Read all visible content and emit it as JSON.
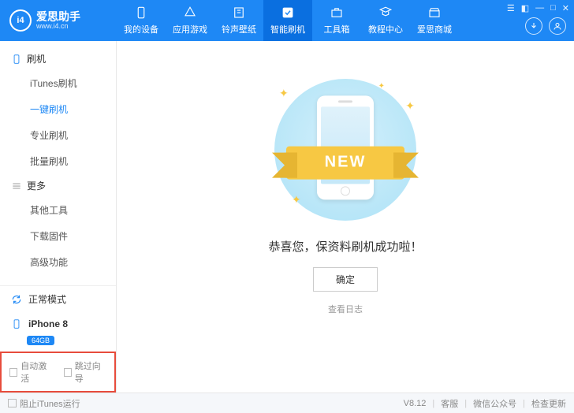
{
  "logo": {
    "badge": "i4",
    "title": "爱思助手",
    "url": "www.i4.cn"
  },
  "nav": [
    {
      "label": "我的设备",
      "icon": "device"
    },
    {
      "label": "应用游戏",
      "icon": "apps"
    },
    {
      "label": "铃声壁纸",
      "icon": "ringtone"
    },
    {
      "label": "智能刷机",
      "icon": "flash",
      "active": true
    },
    {
      "label": "工具箱",
      "icon": "toolbox"
    },
    {
      "label": "教程中心",
      "icon": "tutorial"
    },
    {
      "label": "爱思商城",
      "icon": "store"
    }
  ],
  "sidebar": {
    "group1": {
      "title": "刷机",
      "items": [
        "iTunes刷机",
        "一键刷机",
        "专业刷机",
        "批量刷机"
      ],
      "activeIndex": 1
    },
    "group2": {
      "title": "更多",
      "items": [
        "其他工具",
        "下载固件",
        "高级功能"
      ]
    },
    "mode": "正常模式",
    "device": {
      "name": "iPhone 8",
      "storage": "64GB"
    },
    "checks": {
      "autoActivate": "自动激活",
      "skipGuide": "跳过向导"
    }
  },
  "main": {
    "ribbon": "NEW",
    "message": "恭喜您，保资料刷机成功啦！",
    "okButton": "确定",
    "logLink": "查看日志"
  },
  "footer": {
    "blockItunes": "阻止iTunes运行",
    "version": "V8.12",
    "support": "客服",
    "wechat": "微信公众号",
    "update": "检查更新"
  }
}
